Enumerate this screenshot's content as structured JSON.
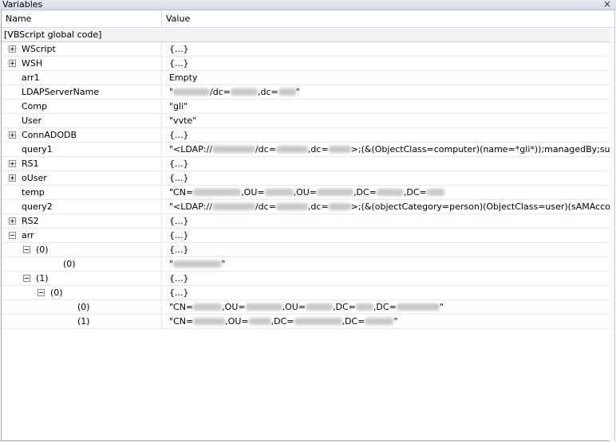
{
  "window": {
    "title": "Variables"
  },
  "columns": {
    "name": "Name",
    "value": "Value"
  },
  "group_label": "[VBScript global code]",
  "rows": [
    {
      "name": "WScript",
      "value": "{...}",
      "expander": "plus",
      "depth": 0
    },
    {
      "name": "WSH",
      "value": "{...}",
      "expander": "plus",
      "depth": 0
    },
    {
      "name": "arr1",
      "value": "Empty",
      "expander": "none",
      "depth": 0
    },
    {
      "name": "LDAPServerName",
      "value": "\"[redacted]/dc=[redacted],dc=[redacted]\"",
      "expander": "none",
      "depth": 0
    },
    {
      "name": "Comp",
      "value": "\"gli\"",
      "expander": "none",
      "depth": 0
    },
    {
      "name": "User",
      "value": "\"vvte\"",
      "expander": "none",
      "depth": 0
    },
    {
      "name": "ConnADODB",
      "value": "{...}",
      "expander": "plus",
      "depth": 0
    },
    {
      "name": "query1",
      "value": "\"<LDAP://[redacted]/dc=[redacted],dc=[redacted]>;(&(ObjectClass=computer)(name=*gli*));managedBy;subtr",
      "expander": "none",
      "depth": 0
    },
    {
      "name": "RS1",
      "value": "{...}",
      "expander": "plus",
      "depth": 0
    },
    {
      "name": "oUser",
      "value": "{...}",
      "expander": "plus",
      "depth": 0
    },
    {
      "name": "temp",
      "value": "\"CN=[redacted],OU=[redacted],OU=[redacted],DC=[redacted],DC=[redacted]",
      "expander": "none",
      "depth": 0
    },
    {
      "name": "query2",
      "value": "\"<LDAP://[redacted]/dc=[redacted],dc=[redacted]>;(&(objectCategory=person)(ObjectClass=user)(sAMAccour",
      "expander": "none",
      "depth": 0
    },
    {
      "name": "RS2",
      "value": "{...}",
      "expander": "plus",
      "depth": 0
    },
    {
      "name": "arr",
      "value": "{...}",
      "expander": "minus",
      "depth": 0
    },
    {
      "name": "(0)",
      "value": "{...}",
      "expander": "minus",
      "depth": 1
    },
    {
      "name": "(0)",
      "value": "\"[redacted]\"",
      "expander": "none",
      "depth": 2
    },
    {
      "name": "(1)",
      "value": "{...}",
      "expander": "minus",
      "depth": 1
    },
    {
      "name": "(0)",
      "value": "{...}",
      "expander": "minus",
      "depth": 2
    },
    {
      "name": "(0)",
      "value": "\"CN=[redacted],OU=[redacted],OU=[redacted],DC=[redacted],DC=[redacted]\"",
      "expander": "none",
      "depth": 3
    },
    {
      "name": "(1)",
      "value": "\"CN=[redacted],OU=[redacted],DC=[redacted],DC=[redacted]\"",
      "expander": "none",
      "depth": 3
    }
  ],
  "icons": {
    "close": "close-icon",
    "expand": "plus-box-icon",
    "collapse": "minus-box-icon"
  },
  "colors": {
    "title_bar": "#dde2ec",
    "group_row": "#f3f3f3",
    "grid": "#e8e8e8"
  }
}
